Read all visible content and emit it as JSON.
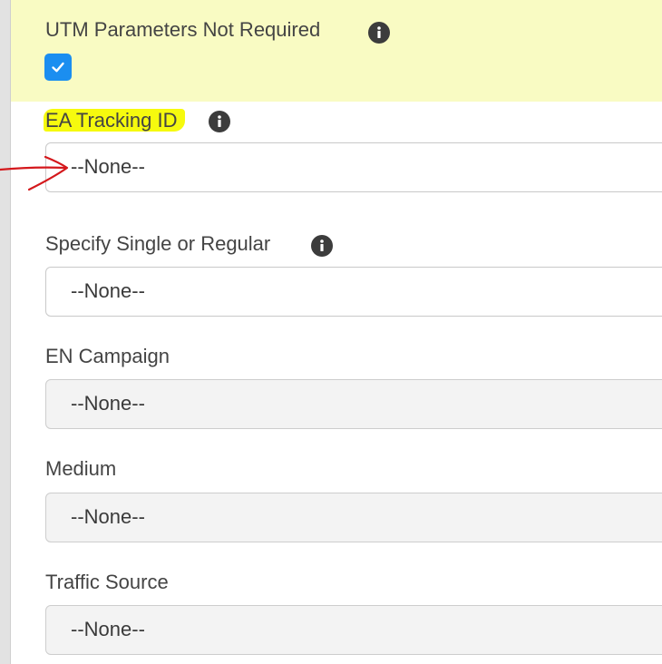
{
  "fields": [
    {
      "label": "UTM Parameters Not Required",
      "type": "checkbox",
      "checked": true,
      "has_info": true,
      "icon": "info-icon"
    },
    {
      "label": "EA Tracking ID",
      "type": "select",
      "value": "--None--",
      "has_info": true,
      "icon": "info-icon",
      "disabled": false
    },
    {
      "label": "Specify Single or Regular",
      "type": "select",
      "value": "--None--",
      "has_info": true,
      "icon": "info-icon",
      "disabled": false
    },
    {
      "label": "EN Campaign",
      "type": "select",
      "value": "--None--",
      "has_info": false,
      "disabled": true
    },
    {
      "label": "Medium",
      "type": "select",
      "value": "--None--",
      "has_info": false,
      "disabled": true
    },
    {
      "label": "Traffic Source",
      "type": "select",
      "value": "--None--",
      "has_info": false,
      "disabled": true
    }
  ],
  "annotations": {
    "highlight_color": "#f6fa0e",
    "band_color": "#f9fbc3",
    "arrow_color": "#d4181c",
    "arrow_icon": "hand-drawn-arrow-icon"
  },
  "colors": {
    "checkbox_accent": "#1b8ef0",
    "info_icon": "#3c3c3c",
    "disabled_fill": "#f3f3f3"
  }
}
